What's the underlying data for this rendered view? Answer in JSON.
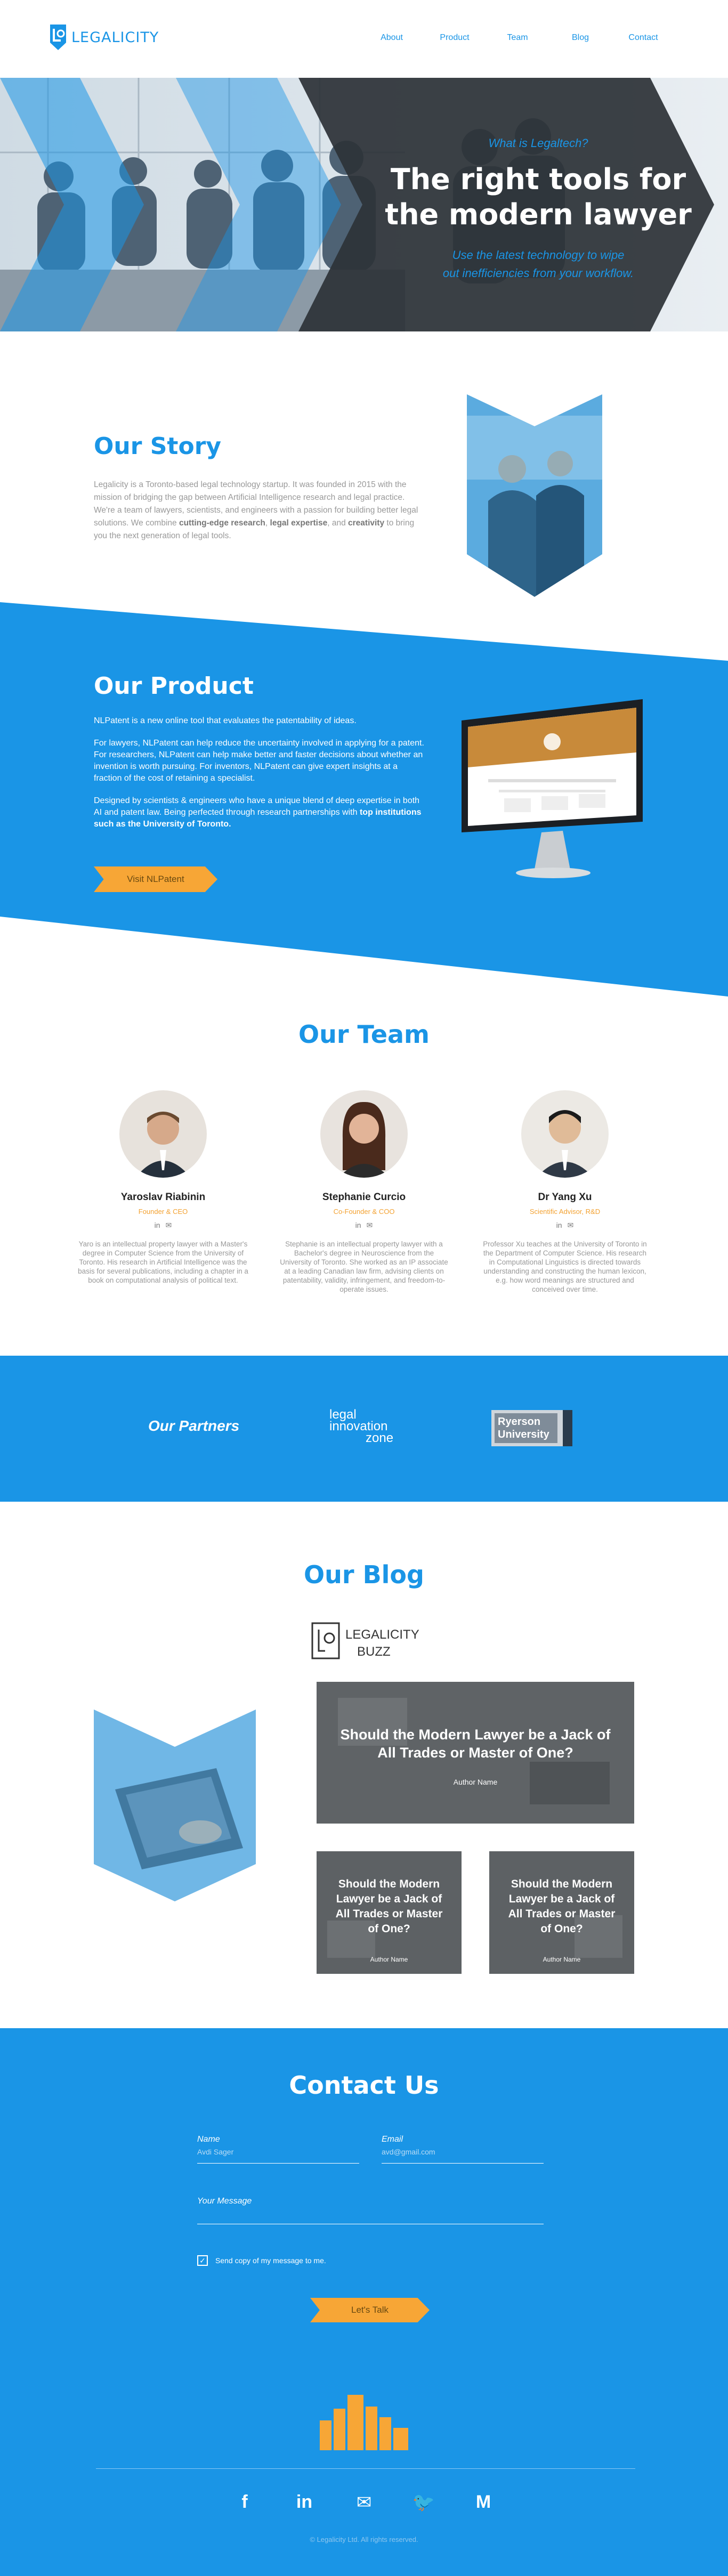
{
  "nav": {
    "logo_text": "LEGALICITY",
    "links": [
      "About",
      "Product",
      "Team",
      "Blog",
      "Contact"
    ]
  },
  "hero": {
    "eyebrow": "What is Legaltech?",
    "title_line1": "The right tools for",
    "title_line2": "the modern lawyer",
    "sub_line1": "Use the latest technology to wipe",
    "sub_line2": "out inefficiencies from your workflow."
  },
  "story": {
    "title": "Our Story",
    "text_part1": "Legalicity is a Toronto-based legal technology startup. It was founded in 2015 with the mission of bridging the gap between Artificial Intelligence research and legal practice. We're a team of lawyers, scientists, and engineers with a passion for building better legal solutions. We combine ",
    "bold1": "cutting-edge research",
    "text_part2": ", ",
    "bold2": "legal expertise",
    "text_part3": ", and ",
    "bold3": "creativity",
    "text_part4": " to bring you the next generation of legal tools."
  },
  "product": {
    "title": "Our Product",
    "p1": "NLPatent is a new online tool that evaluates the patentability of ideas.",
    "p2": "For lawyers, NLPatent can help reduce the uncertainty involved in applying for a patent. For researchers, NLPatent can help make better and faster decisions about whether an invention is worth pursuing. For inventors, NLPatent can give expert insights at a fraction of the cost of retaining a specialist.",
    "p3_part1": "Designed by scientists & engineers who have a unique blend of deep expertise in both AI and patent law. Being perfected through research partnerships with ",
    "p3_bold": "top institutions such as the University of Toronto.",
    "cta": "Visit NLPatent"
  },
  "team": {
    "title": "Our Team",
    "members": [
      {
        "name": "Yaroslav Riabinin",
        "role": "Founder & CEO",
        "bio": "Yaro is an intellectual property lawyer with a Master's degree in Computer Science from the University of Toronto. His research in Artificial Intelligence was the basis for several publications, including a chapter in a book on computational analysis of political text."
      },
      {
        "name": "Stephanie Curcio",
        "role": "Co-Founder & COO",
        "bio": "Stephanie is an intellectual property lawyer with a Bachelor's degree in Neuroscience from the University of Toronto. She worked as an IP associate at a leading Canadian law firm, advising clients on patentability, validity, infringement, and freedom-to-operate issues."
      },
      {
        "name": "Dr Yang Xu",
        "role": "Scientific Advisor, R&D",
        "bio": "Professor Xu teaches at the University of Toronto in the Department of Computer Science. His research in Computational Linguistics is directed towards understanding and constructing the human lexicon, e.g. how word meanings are structured and conceived over time."
      }
    ],
    "icon_linkedin": "in",
    "icon_email": "✉"
  },
  "partners": {
    "title": "Our Partners",
    "lic_line1": "legal",
    "lic_line2": "innovation",
    "lic_line3": "zone",
    "ryerson_line1": "Ryerson",
    "ryerson_line2": "University"
  },
  "blog": {
    "title": "Our Blog",
    "buzz_line1": "LEGALICITY",
    "buzz_line2": "BUZZ",
    "featured": {
      "title": "Should the Modern Lawyer be a Jack of All Trades or Master of One?",
      "author": "Author Name"
    },
    "posts": [
      {
        "title": "Should the Modern Lawyer be a Jack of All Trades or Master of One?",
        "author": "Author Name"
      },
      {
        "title": "Should the Modern Lawyer be a Jack of All Trades or Master of One?",
        "author": "Author Name"
      }
    ]
  },
  "contact": {
    "title": "Contact Us",
    "name_label": "Name",
    "name_value": "Avdi Sager",
    "email_label": "Email",
    "email_value": "avd@gmail.com",
    "message_label": "Your Message",
    "checkbox_label": "Send copy of my message to me.",
    "submit": "Let's Talk",
    "socials": [
      "f",
      "in",
      "✉",
      "🐦",
      "M"
    ],
    "copyright": "© Legalicity Ltd. All rights reserved."
  },
  "colors": {
    "primary": "#1a95e6",
    "accent": "#f7a636",
    "dark": "#2d3338"
  }
}
